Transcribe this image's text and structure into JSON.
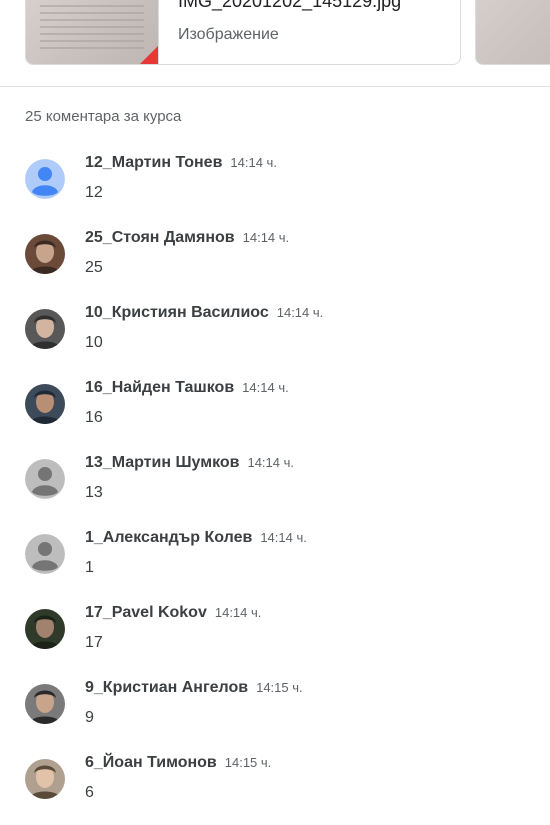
{
  "attachment": {
    "name": "IMG_20201202_145129.jpg",
    "type": "Изображение"
  },
  "comments_header": "25 коментара за курса",
  "comments": [
    {
      "author": "12_Мартин Тонев",
      "time": "14:14 ч.",
      "text": "12",
      "avatar": "default-blue"
    },
    {
      "author": "25_Стоян Дамянов",
      "time": "14:14 ч.",
      "text": "25",
      "avatar": "photo"
    },
    {
      "author": "10_Кристиян Василиос",
      "time": "14:14 ч.",
      "text": "10",
      "avatar": "photo"
    },
    {
      "author": "16_Найден Ташков",
      "time": "14:14 ч.",
      "text": "16",
      "avatar": "photo"
    },
    {
      "author": "13_Мартин Шумков",
      "time": "14:14 ч.",
      "text": "13",
      "avatar": "default-gray"
    },
    {
      "author": "1_Александър Колев",
      "time": "14:14 ч.",
      "text": "1",
      "avatar": "default-gray"
    },
    {
      "author": "17_Pavel Kokov",
      "time": "14:14 ч.",
      "text": "17",
      "avatar": "photo"
    },
    {
      "author": "9_Кристиан Ангелов",
      "time": "14:15 ч.",
      "text": "9",
      "avatar": "photo"
    },
    {
      "author": "6_Йоан Тимонов",
      "time": "14:15 ч.",
      "text": "6",
      "avatar": "photo"
    }
  ],
  "colors": {
    "default_blue_bg": "#aecbfa",
    "default_blue_fg": "#4285f4",
    "default_gray_bg": "#bdbdbd",
    "default_gray_fg": "#757575"
  }
}
